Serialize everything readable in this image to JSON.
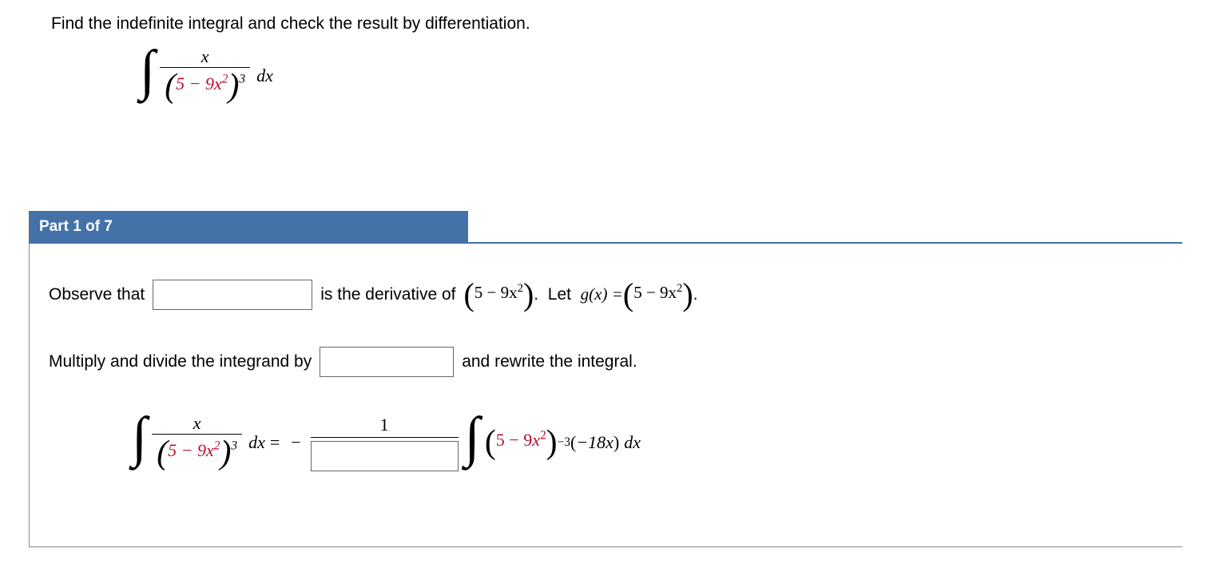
{
  "intro": "Find the indefinite integral and check the result by differentiation.",
  "problem": {
    "numerator": "x",
    "inner_const": "5",
    "inner_coef": "9",
    "inner_var": "x",
    "inner_exp": "2",
    "outer_exp": "3",
    "dx": "dx"
  },
  "part_label": "Part 1 of 7",
  "line1": {
    "pre": "Observe that",
    "mid": "is the derivative of",
    "expr_a": "5",
    "expr_b": "9x",
    "expr_sup": "2",
    "let_txt": ".  Let  ",
    "g_eq": "g(x) = ",
    "period": "."
  },
  "line2": {
    "pre": "Multiply and divide the integrand by",
    "post": "and rewrite the integral."
  },
  "equation": {
    "eq": " = ",
    "minus": "−",
    "frac_num": "1",
    "neg_exp": "−3",
    "tail_open": "(",
    "tail_inner": "−18x",
    "tail_close": ")",
    "dx": "dx"
  }
}
